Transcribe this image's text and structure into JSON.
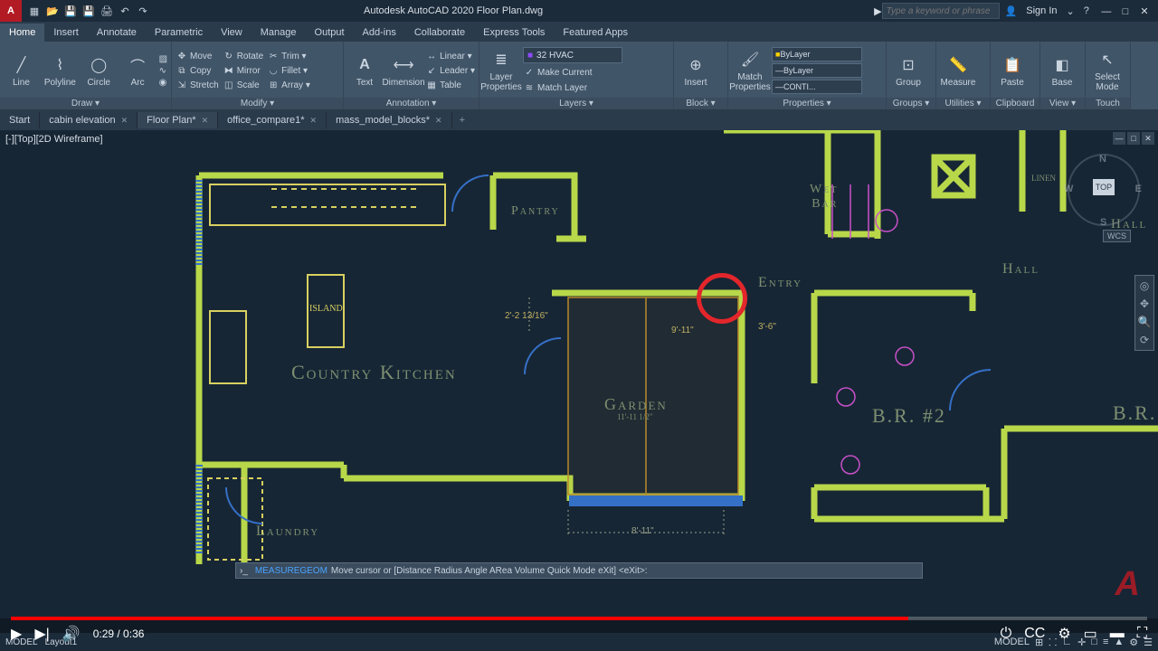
{
  "app": {
    "title": "Autodesk AutoCAD 2020   Floor Plan.dwg",
    "search_placeholder": "Type a keyword or phrase",
    "signin": "Sign In"
  },
  "menu": {
    "tabs": [
      "Home",
      "Insert",
      "Annotate",
      "Parametric",
      "View",
      "Manage",
      "Output",
      "Add-ins",
      "Collaborate",
      "Express Tools",
      "Featured Apps"
    ],
    "active": 0
  },
  "ribbon": {
    "draw": {
      "label": "Draw ▾",
      "line": "Line",
      "polyline": "Polyline",
      "circle": "Circle",
      "arc": "Arc"
    },
    "modify": {
      "label": "Modify ▾",
      "move": "Move",
      "rotate": "Rotate",
      "trim": "Trim ▾",
      "copy": "Copy",
      "mirror": "Mirror",
      "fillet": "Fillet ▾",
      "stretch": "Stretch",
      "scale": "Scale",
      "array": "Array ▾"
    },
    "annotation": {
      "label": "Annotation ▾",
      "text": "Text",
      "dimension": "Dimension",
      "linear": "Linear ▾",
      "leader": "Leader ▾",
      "table": "Table"
    },
    "layers": {
      "label": "Layers ▾",
      "props": "Layer Properties",
      "current": "32 HVAC",
      "makecurrent": "Make Current",
      "matchlayer": "Match Layer"
    },
    "block": {
      "label": "Block ▾",
      "insert": "Insert"
    },
    "properties": {
      "label": "Properties ▾",
      "match": "Match Properties",
      "color": "ByLayer",
      "line": "ByLayer",
      "lw": "CONTI..."
    },
    "groups": {
      "label": "Groups ▾",
      "group": "Group"
    },
    "utilities": {
      "label": "Utilities ▾",
      "measure": "Measure"
    },
    "clipboard": {
      "label": "Clipboard",
      "paste": "Paste"
    },
    "view": {
      "label": "View ▾",
      "base": "Base"
    },
    "touch": {
      "label": "Touch",
      "select": "Select Mode"
    }
  },
  "filetabs": {
    "items": [
      "Start",
      "cabin elevation",
      "Floor Plan*",
      "office_compare1*",
      "mass_model_blocks*"
    ],
    "active": 2
  },
  "viewport": {
    "label": "[-][Top][2D Wireframe]",
    "cube_face": "TOP",
    "wcs": "WCS"
  },
  "rooms": {
    "pantry": "Pantry",
    "kitchen": "Country Kitchen",
    "island": "ISLAND",
    "laundry": "Laundry",
    "garden": "Garden",
    "garden_dim": "11'-11 1/2\"",
    "entry": "Entry",
    "wetbar": "Wet\nBar",
    "hall": "Hall",
    "hall2": "Hall",
    "linen": "LINEN",
    "br2": "B.R. #2",
    "br": "B.R."
  },
  "dims": {
    "d1": "2'-2 13/16\"",
    "d2": "9'-11\"",
    "d3": "3'-6\"",
    "d4": "8'-11\""
  },
  "command": {
    "name": "MEASUREGEOM",
    "hint": "Move cursor or [Distance Radius Angle ARea Volume Quick Mode eXit] <eXit>:"
  },
  "status": {
    "model": "MODEL"
  },
  "video": {
    "time": "0:29 / 0:36"
  }
}
